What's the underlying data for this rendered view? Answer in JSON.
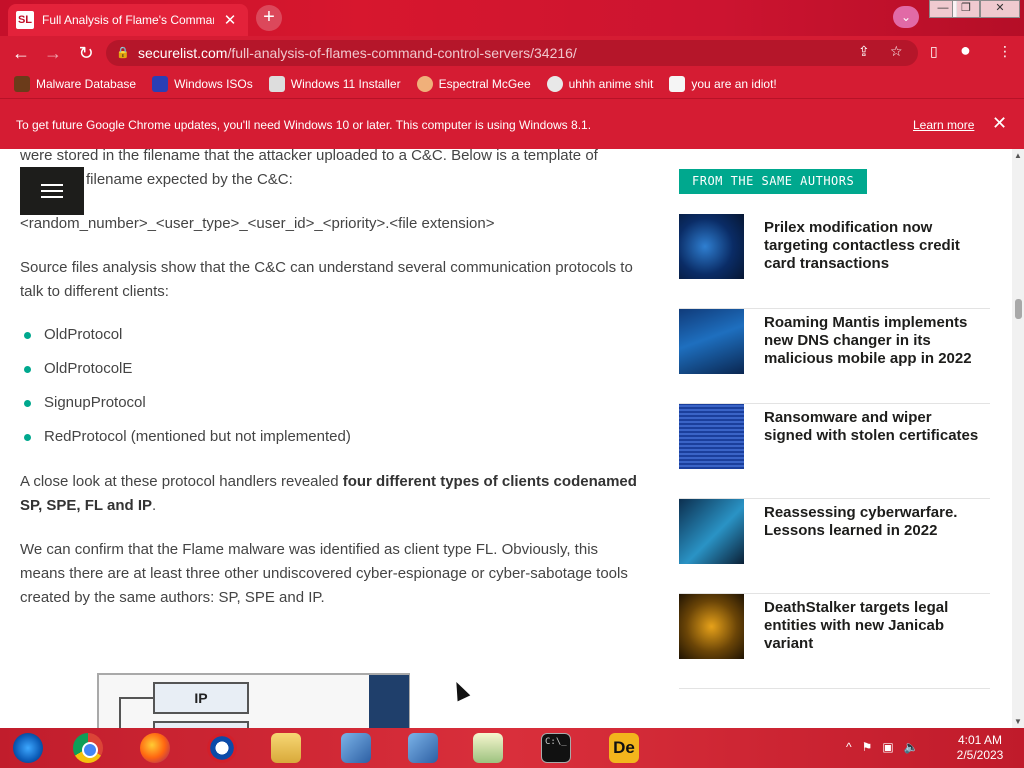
{
  "browser": {
    "tab": {
      "favicon": "SL",
      "title": "Full Analysis of Flame's Command",
      "close": "✕"
    },
    "new_tab": "+",
    "profile_chip": "⌄",
    "window_controls": {
      "minimize": "—",
      "maximize": "❐",
      "close": "✕"
    },
    "nav": {
      "back": "←",
      "forward": "→",
      "reload": "↻"
    },
    "url": {
      "host": "securelist.com",
      "path": "/full-analysis-of-flames-command-control-servers/34216/"
    },
    "omnibox_icons": {
      "share": "⇪",
      "star": "☆",
      "sidepanel": "▯",
      "profile": "●",
      "menu": "⋮"
    },
    "bookmarks": [
      {
        "label": "Malware Database",
        "icon": "malware-icon",
        "color": "#6b3b1a"
      },
      {
        "label": "Windows ISOs",
        "icon": "x-icon",
        "color": "#2a3fb5"
      },
      {
        "label": "Windows 11 Installer",
        "icon": "page-icon",
        "color": "#dddddd"
      },
      {
        "label": "Espectral McGee",
        "icon": "avatar-icon",
        "color": "#f0b07a"
      },
      {
        "label": "uhhh anime shit",
        "icon": "anime-icon",
        "color": "#e8e8e8"
      },
      {
        "label": "you are an idiot!",
        "icon": "idiot-icon",
        "color": "#f5f5f5"
      }
    ],
    "infobar": {
      "message": "To get future Google Chrome updates, you'll need Windows 10 or later. This computer is using Windows 8.1.",
      "link": "Learn more",
      "close": "✕"
    }
  },
  "article": {
    "p1": "were stored in the filename that the attacker uploaded to a C&C. Below is a template of",
    "p1b": "filename expected by the C&C:",
    "template": "<random_number>_<user_type>_<user_id>_<priority>.<file extension>",
    "p2": "Source files analysis show that the C&C can understand several communication protocols to talk to different clients:",
    "protocols": [
      "OldProtocol",
      "OldProtocolE",
      "SignupProtocol",
      "RedProtocol (mentioned but not implemented)"
    ],
    "p3_lead": "A close look at these protocol handlers revealed ",
    "p3_strong": "four different types of clients codenamed SP, SPE, FL and IP",
    "p3_end": ".",
    "p4": "We can confirm that the Flame malware was identified as client type FL. Obviously, this means there are at least three other undiscovered cyber-espionage or cyber-sabotage tools created by the same authors: SP, SPE and IP.",
    "figure_label": "IP"
  },
  "sidebar": {
    "heading": "FROM THE SAME AUTHORS",
    "items": [
      {
        "title": "Prilex modification now targeting contactless credit card transactions"
      },
      {
        "title": "Roaming Mantis implements new DNS changer in its malicious mobile app in 2022"
      },
      {
        "title": "Ransomware and wiper signed with stolen certificates"
      },
      {
        "title": "Reassessing cyberwarfare. Lessons learned in 2022"
      },
      {
        "title": "DeathStalker targets legal entities with new Janicab variant"
      }
    ]
  },
  "taskbar": {
    "apps": [
      "start",
      "chrome",
      "firefox",
      "obama",
      "file-explorer",
      "network-1",
      "network-2",
      "notepad",
      "cmd",
      "de"
    ],
    "cmd_text": "C:\\_",
    "de_text": "De",
    "tray": {
      "chevron": "^",
      "flag": "⚑",
      "network": "▣",
      "volume": "🔈"
    },
    "time": "4:01 AM",
    "date": "2/5/2023"
  }
}
